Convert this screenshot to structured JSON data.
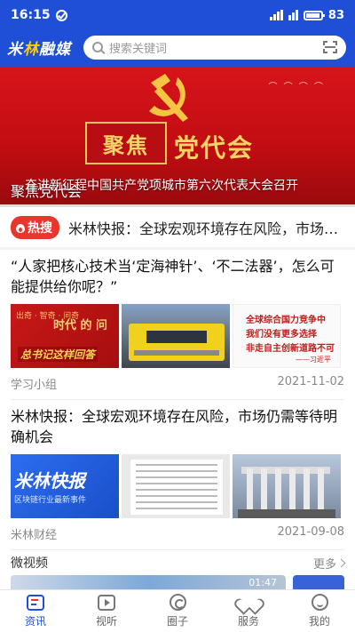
{
  "status": {
    "time": "16:15",
    "battery": "83"
  },
  "header": {
    "logo_a": "米",
    "logo_b": "林",
    "logo_c": "融媒",
    "search_placeholder": "搜索关键词"
  },
  "banner": {
    "focus": "聚焦",
    "party_meeting": "党代会",
    "headline": "共产党员城市第六次代表大会召开",
    "headline_full": "奋进新征程中国共产党项城市第六次代表大会召开",
    "caption": "聚焦党代会"
  },
  "hot": {
    "badge": "热搜",
    "text": "米林快报：全球宏观环境存在风险，市场仍需等待明确机会"
  },
  "articles": [
    {
      "title": "“人家把核心技术当‘定海神针’、‘不二法器’，怎么可能提供给你呢？”",
      "thumb1_small": "出奇 · 智奇 · 问奇",
      "thumb1_big": "时代 的 问",
      "thumb1_bottom": "总书记这样回答",
      "thumb3_lines": [
        "全球综合国力竞争中",
        "我们没有更多选择",
        "非走自主创新道路不可"
      ],
      "thumb3_sig": "——习近平",
      "source": "学习小组",
      "date": "2021-11-02"
    },
    {
      "title": "米林快报：全球宏观环境存在风险，市场仍需等待明确机会",
      "thumb4_big": "米林快报",
      "thumb4_small": "区块链行业最新事件",
      "source": "米林财经",
      "date": "2021-09-08"
    }
  ],
  "section": {
    "title": "微视频",
    "more": "更多",
    "video_time": "01:47"
  },
  "nav": [
    {
      "label": "资讯",
      "icon": "news-icon"
    },
    {
      "label": "视听",
      "icon": "video-icon"
    },
    {
      "label": "圈子",
      "icon": "circle-icon"
    },
    {
      "label": "服务",
      "icon": "heart-icon"
    },
    {
      "label": "我的",
      "icon": "me-icon"
    }
  ],
  "colors": {
    "brand": "#1e4fd6",
    "hot": "#e8362c",
    "banner": "#d7141a"
  }
}
